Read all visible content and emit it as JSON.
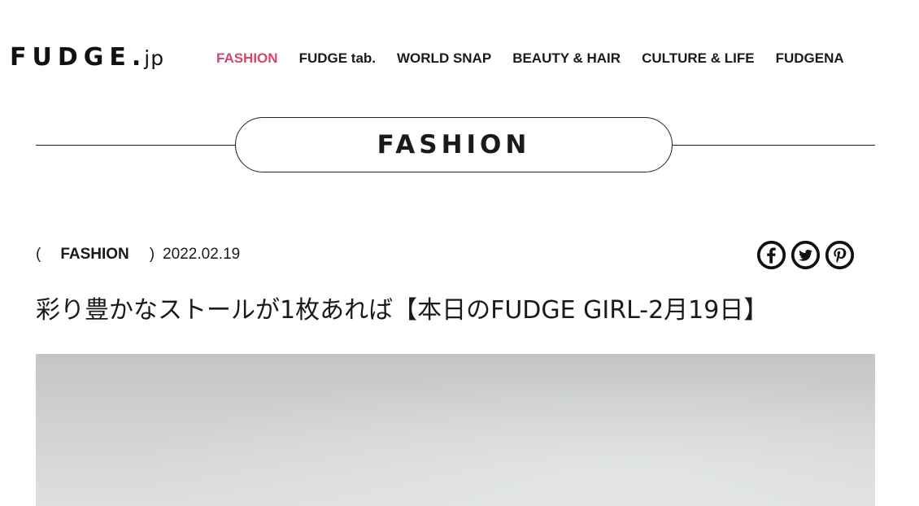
{
  "header": {
    "logo_main": "FUDGE.",
    "logo_suffix": "jp",
    "nav": [
      {
        "label": "FASHION",
        "active": true
      },
      {
        "label": "FUDGE tab.",
        "active": false
      },
      {
        "label": "WORLD SNAP",
        "active": false
      },
      {
        "label": "BEAUTY & HAIR",
        "active": false
      },
      {
        "label": "CULTURE & LIFE",
        "active": false
      },
      {
        "label": "FUDGENA",
        "active": false
      }
    ]
  },
  "section": {
    "title": "FASHION"
  },
  "article": {
    "paren_open": "(",
    "category": "FASHION",
    "paren_close": ")",
    "date": "2022.02.19",
    "title": "彩り豊かなストールが1枚あれば【本日のFUDGE GIRL-2月19日】",
    "share_icons": [
      "facebook-icon",
      "twitter-icon",
      "pinterest-icon"
    ]
  },
  "colors": {
    "accent": "#d6456e",
    "text": "#1a1a1a",
    "hero_placeholder": "#cfd2d0"
  }
}
